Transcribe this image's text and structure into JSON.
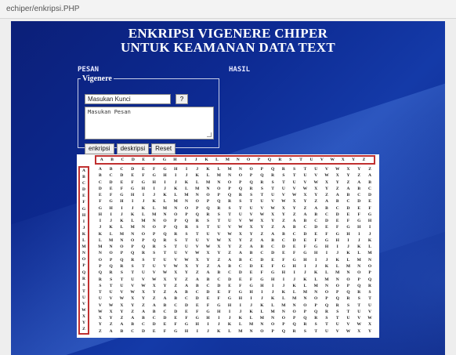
{
  "browser": {
    "address": "echiper/enkripsi.PHP"
  },
  "header": {
    "title_line1": "ENKRIPSI VIGENERE CHIPER",
    "title_line2": "UNTUK KEAMANAN DATA TEXT"
  },
  "labels": {
    "pesan": "PESAN",
    "hasil": "HASIL"
  },
  "form": {
    "legend": "Vigenere",
    "key_value": "Masukan Kunci",
    "help_label": "?",
    "message_placeholder": "Masukan Pesan",
    "buttons": {
      "encrypt": "enkripsi",
      "decrypt": "deskripsi",
      "reset": "Reset"
    }
  },
  "table": {
    "letters": [
      "A",
      "B",
      "C",
      "D",
      "E",
      "F",
      "G",
      "H",
      "I",
      "J",
      "K",
      "L",
      "M",
      "N",
      "O",
      "P",
      "Q",
      "R",
      "S",
      "T",
      "U",
      "V",
      "W",
      "X",
      "Y",
      "Z"
    ],
    "colors": {
      "highlight_border": "#c03030"
    }
  }
}
